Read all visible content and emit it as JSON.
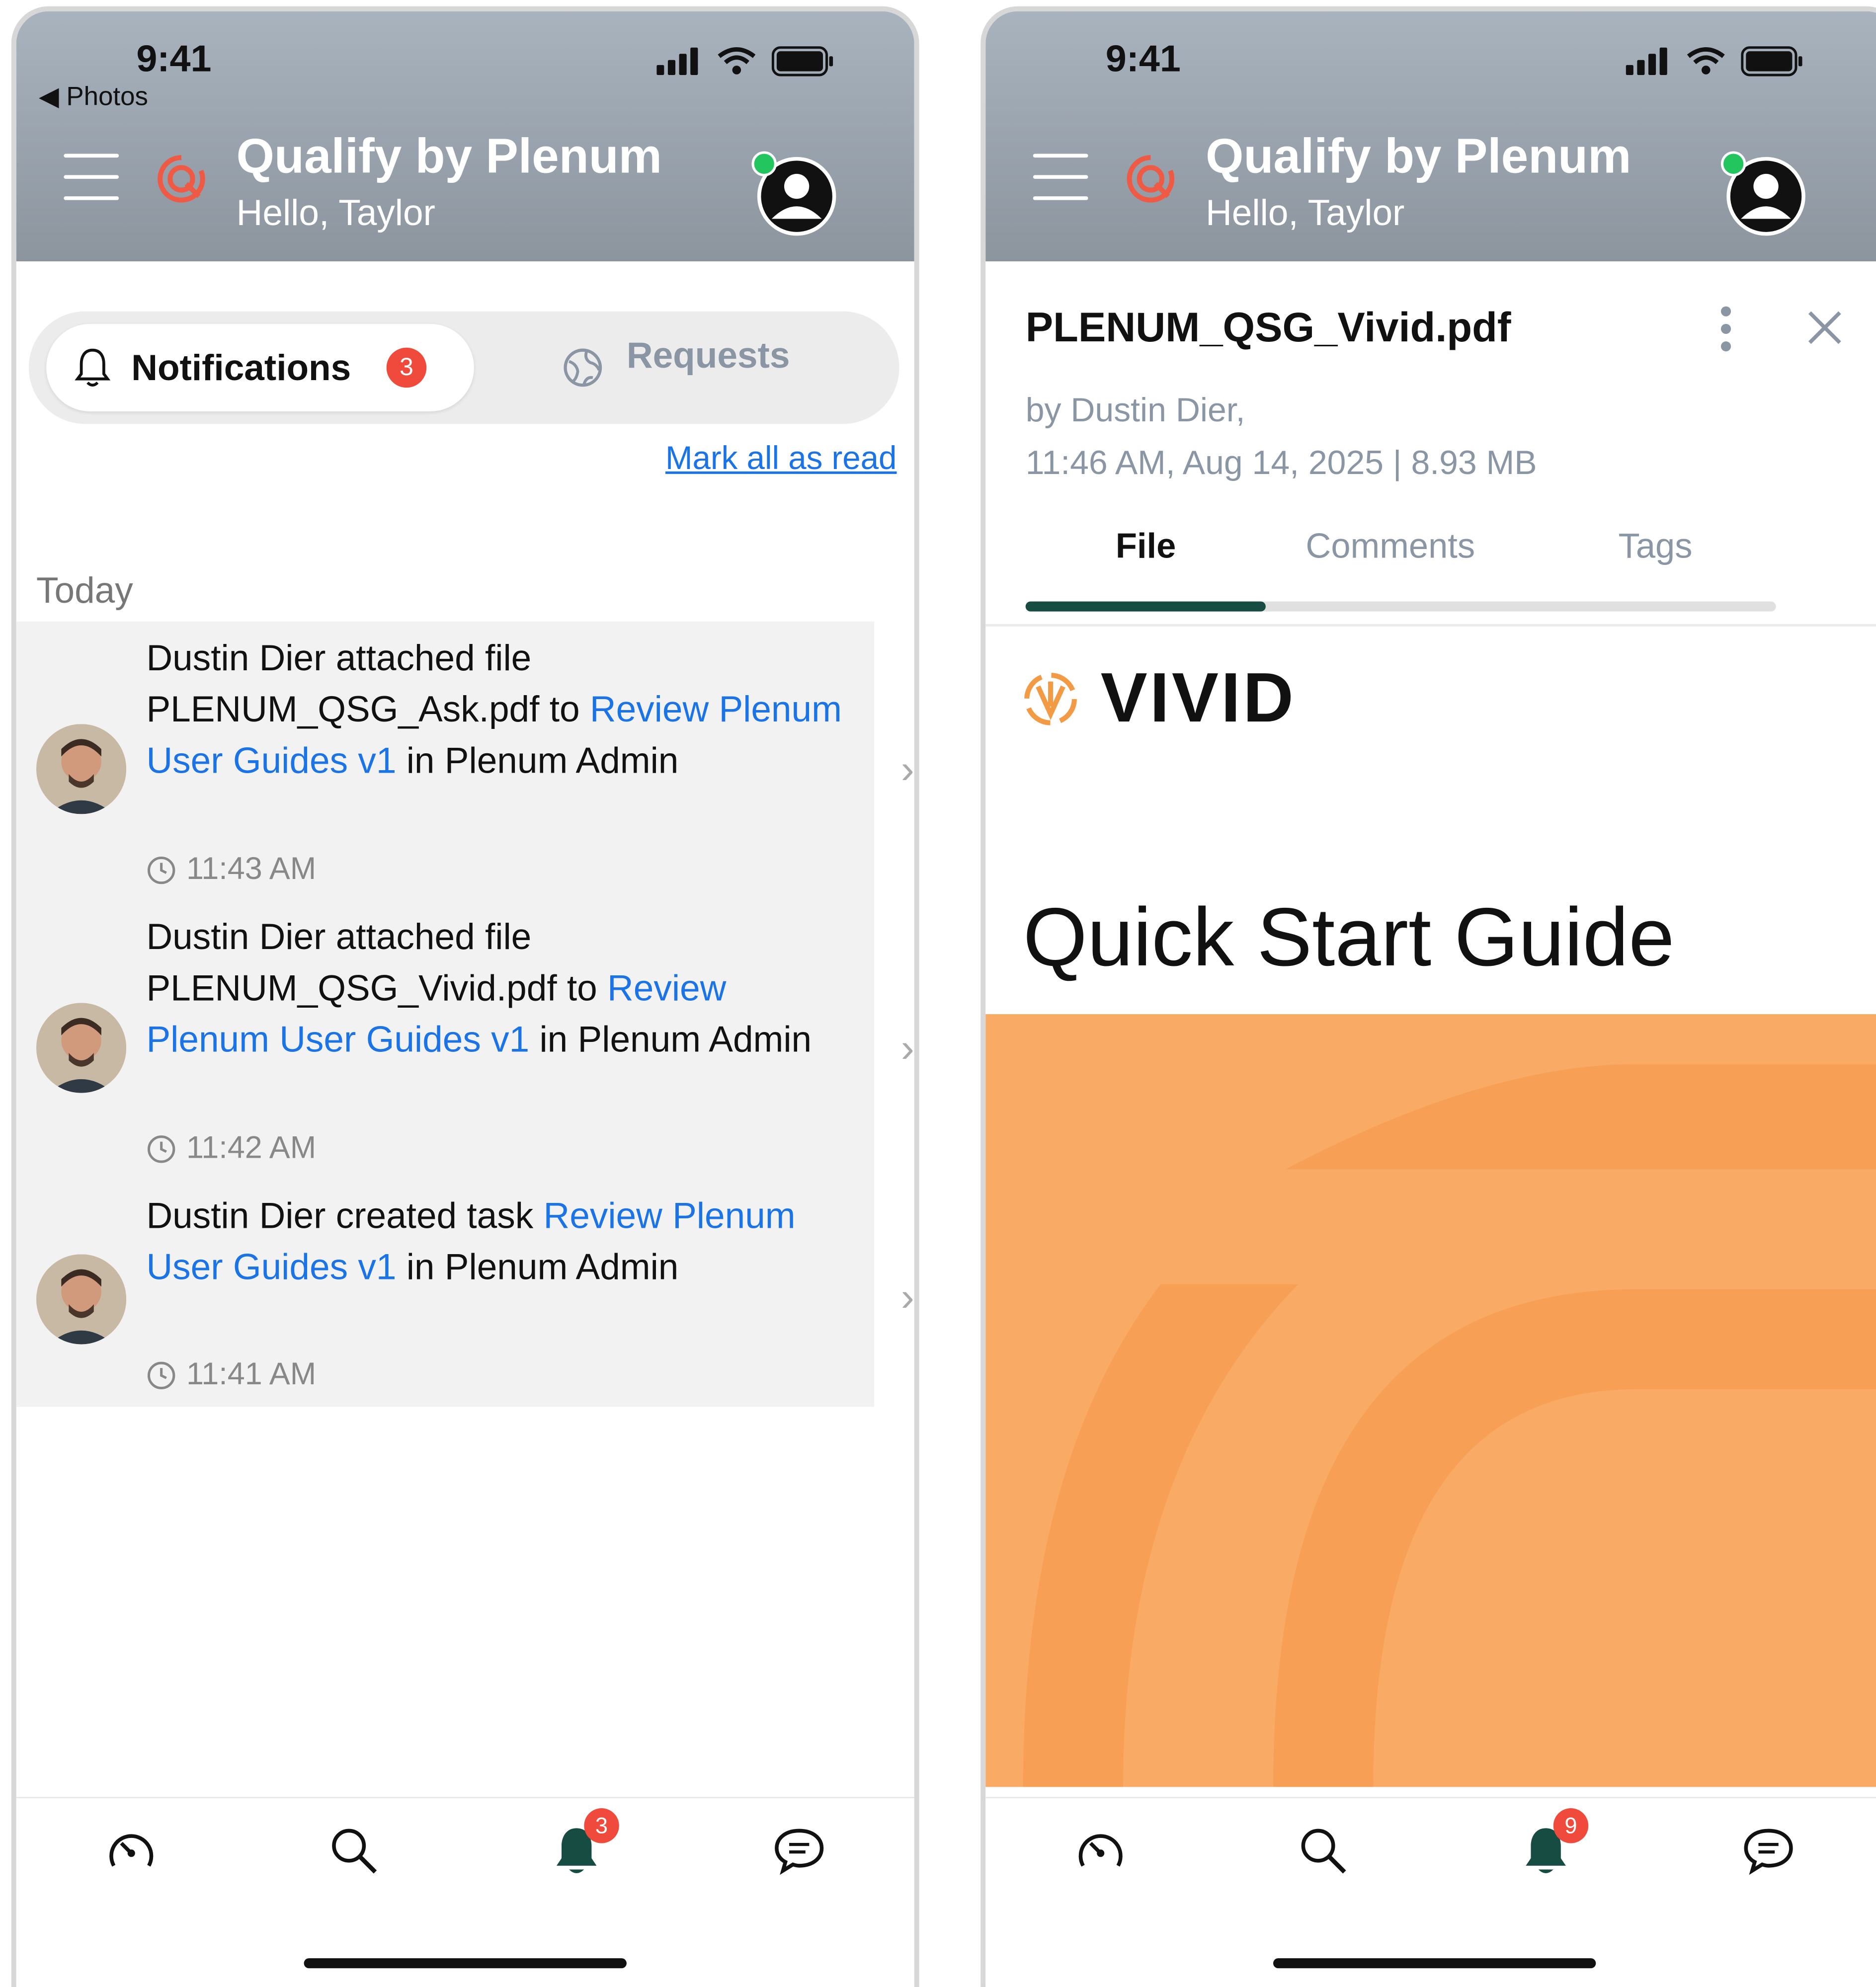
{
  "status_bar": {
    "time": "9:41",
    "back_label": "Photos"
  },
  "app": {
    "title": "Qualify by Plenum",
    "greeting": "Hello, Taylor"
  },
  "left_screen": {
    "segment": {
      "notifications_label": "Notifications",
      "notifications_count": "3",
      "requests_label": "Requests"
    },
    "mark_all_read": "Mark all as read",
    "section_header": "Today",
    "notifications": [
      {
        "prefix": "Dustin Dier attached file PLENUM_QSG_Ask.pdf to ",
        "link": "Review Plenum User Guides v1",
        "suffix": " in Plenum Admin",
        "time": "11:43 AM"
      },
      {
        "prefix": "Dustin Dier attached file PLENUM_QSG_Vivid.pdf to ",
        "link": "Review Plenum User Guides v1",
        "suffix": " in Plenum Admin",
        "time": "11:42 AM"
      },
      {
        "prefix": "Dustin Dier created task ",
        "link": "Review Plenum User Guides v1",
        "suffix": " in Plenum Admin",
        "time": "11:41 AM"
      }
    ],
    "nav_badge": "3"
  },
  "right_screen": {
    "file": {
      "name": "PLENUM_QSG_Vivid.pdf",
      "author": "by Dustin Dier,",
      "details": "11:46 AM, Aug 14, 2025 | 8.93 MB"
    },
    "tabs": [
      {
        "label": "File",
        "active": true
      },
      {
        "label": "Comments",
        "active": false
      },
      {
        "label": "Tags",
        "active": false
      }
    ],
    "tab_progress_fraction": 0.32,
    "preview": {
      "brand": "VIVID",
      "heading": "Quick Start Guide"
    },
    "nav_badge": "9"
  },
  "colors": {
    "link": "#1b73e8",
    "badge": "#ef4a3b",
    "online": "#22c55e",
    "tab_indicator": "#174c43",
    "cover": "#f9ab66",
    "nav_icon_active": "#174c43"
  }
}
